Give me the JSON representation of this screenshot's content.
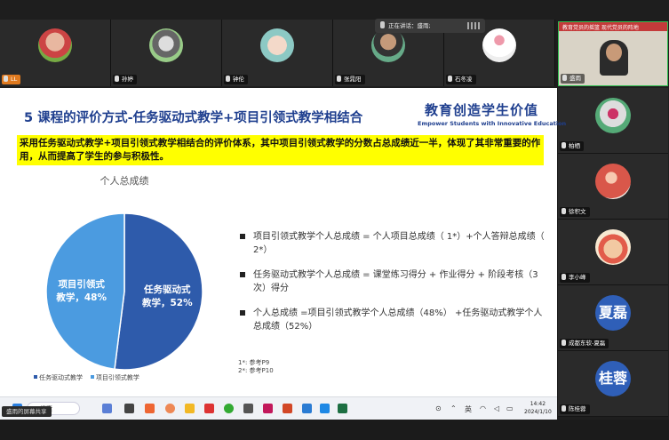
{
  "participants_top": [
    {
      "name": "LL"
    },
    {
      "name": "孙婷"
    },
    {
      "name": "钟伦"
    },
    {
      "name": "张晁阳"
    },
    {
      "name": "石冬凌"
    }
  ],
  "speaking": {
    "label": "正在讲话：盛雨;"
  },
  "presenter": {
    "name": "盛雨",
    "banner": "教育党员的摇篮 现代党员的阵地"
  },
  "participants_right": [
    {
      "name": "柏栖"
    },
    {
      "name": "徐积文"
    },
    {
      "name": "李小峰"
    },
    {
      "name": "成都东软-夏磊",
      "avatar_text": "夏磊"
    },
    {
      "name": "陈桂蓉",
      "avatar_text": "桂蓉"
    }
  ],
  "slide": {
    "title": "5 课程的评价方式-任务驱动式教学+项目引领式教学相结合",
    "logo_cn": "教育创造学生价值",
    "logo_en": "Empower Students with Innovative Education",
    "highlight": "采用任务驱动式教学+项目引领式教学相结合的评价体系，其中项目引领式教学的分数占总成绩近一半，体现了其非常重要的作用，从而提高了学生的参与积极性。",
    "bullets": [
      "项目引领式教学个人总成绩 = 个人项目总成绩（ 1*）+个人答辩总成绩（ 2*）",
      "任务驱动式教学个人总成绩 = 课堂练习得分 + 作业得分 + 阶段考核（3次）得分",
      "个人总成绩 =项目引领式教学个人总成绩（48%） +任务驱动式教学个人总成绩（52%）"
    ],
    "notes": [
      "1*: 参考P9",
      "2*: 参考P10"
    ]
  },
  "chart_data": {
    "type": "pie",
    "title": "个人总成绩",
    "slices": [
      {
        "label": "任务驱动式教学",
        "value": 52,
        "display": "任务驱动式\n教学，52%",
        "color": "#2e5bab"
      },
      {
        "label": "项目引领式教学",
        "value": 48,
        "display": "项目引领式\n教学，48%",
        "color": "#4b9be0"
      }
    ],
    "legend": [
      "任务驱动式教学",
      "项目引领式教学"
    ],
    "legend_placement": "bottom"
  },
  "taskbar": {
    "search_placeholder": "搜索",
    "tray_lang": "英",
    "time": "14:42",
    "date": "2024/1/10"
  },
  "share_status": "盛雨的屏幕共享",
  "colors": {
    "accent": "#1f3f8f",
    "highlight": "#ffff00",
    "presenter_border": "#2fbf4f"
  }
}
